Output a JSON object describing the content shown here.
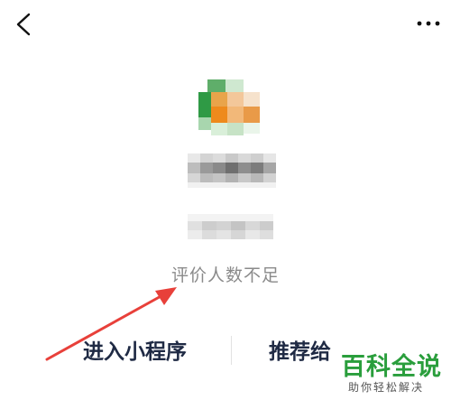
{
  "header": {
    "back_icon": "chevron-left-icon",
    "more_icon": "more-dots-icon"
  },
  "profile": {
    "rating_text": "评价人数不足"
  },
  "actions": {
    "enter_label": "进入小程序",
    "recommend_label": "推荐给"
  },
  "watermark": {
    "title": "百科全说",
    "subtitle": "助你轻松解决"
  },
  "colors": {
    "arrow": "#e8403a",
    "watermark_green": "#2a9e3c",
    "action_text": "#1f2a44"
  }
}
